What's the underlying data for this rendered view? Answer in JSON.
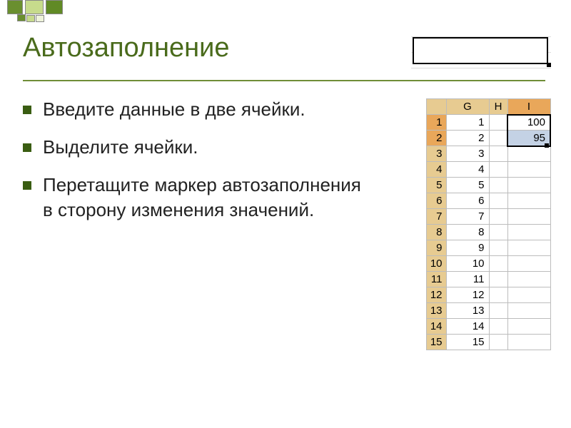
{
  "title": "Автозаполнение",
  "bullets": [
    "Введите данные в две ячейки.",
    "Выделите ячейки.",
    "Перетащите маркер автозаполнения в сторону изменения значений."
  ],
  "spreadsheet": {
    "columns": [
      "G",
      "H",
      "I"
    ],
    "selected_column": "I",
    "rows": [
      {
        "num": 1,
        "g": "1",
        "h": "",
        "i": "100",
        "i_selected": true
      },
      {
        "num": 2,
        "g": "2",
        "h": "",
        "i": "95",
        "i_selected": true
      },
      {
        "num": 3,
        "g": "3",
        "h": "",
        "i": ""
      },
      {
        "num": 4,
        "g": "4",
        "h": "",
        "i": ""
      },
      {
        "num": 5,
        "g": "5",
        "h": "",
        "i": ""
      },
      {
        "num": 6,
        "g": "6",
        "h": "",
        "i": ""
      },
      {
        "num": 7,
        "g": "7",
        "h": "",
        "i": ""
      },
      {
        "num": 8,
        "g": "8",
        "h": "",
        "i": ""
      },
      {
        "num": 9,
        "g": "9",
        "h": "",
        "i": ""
      },
      {
        "num": 10,
        "g": "10",
        "h": "",
        "i": ""
      },
      {
        "num": 11,
        "g": "11",
        "h": "",
        "i": ""
      },
      {
        "num": 12,
        "g": "12",
        "h": "",
        "i": ""
      },
      {
        "num": 13,
        "g": "13",
        "h": "",
        "i": ""
      },
      {
        "num": 14,
        "g": "14",
        "h": "",
        "i": ""
      },
      {
        "num": 15,
        "g": "15",
        "h": "",
        "i": ""
      }
    ]
  }
}
